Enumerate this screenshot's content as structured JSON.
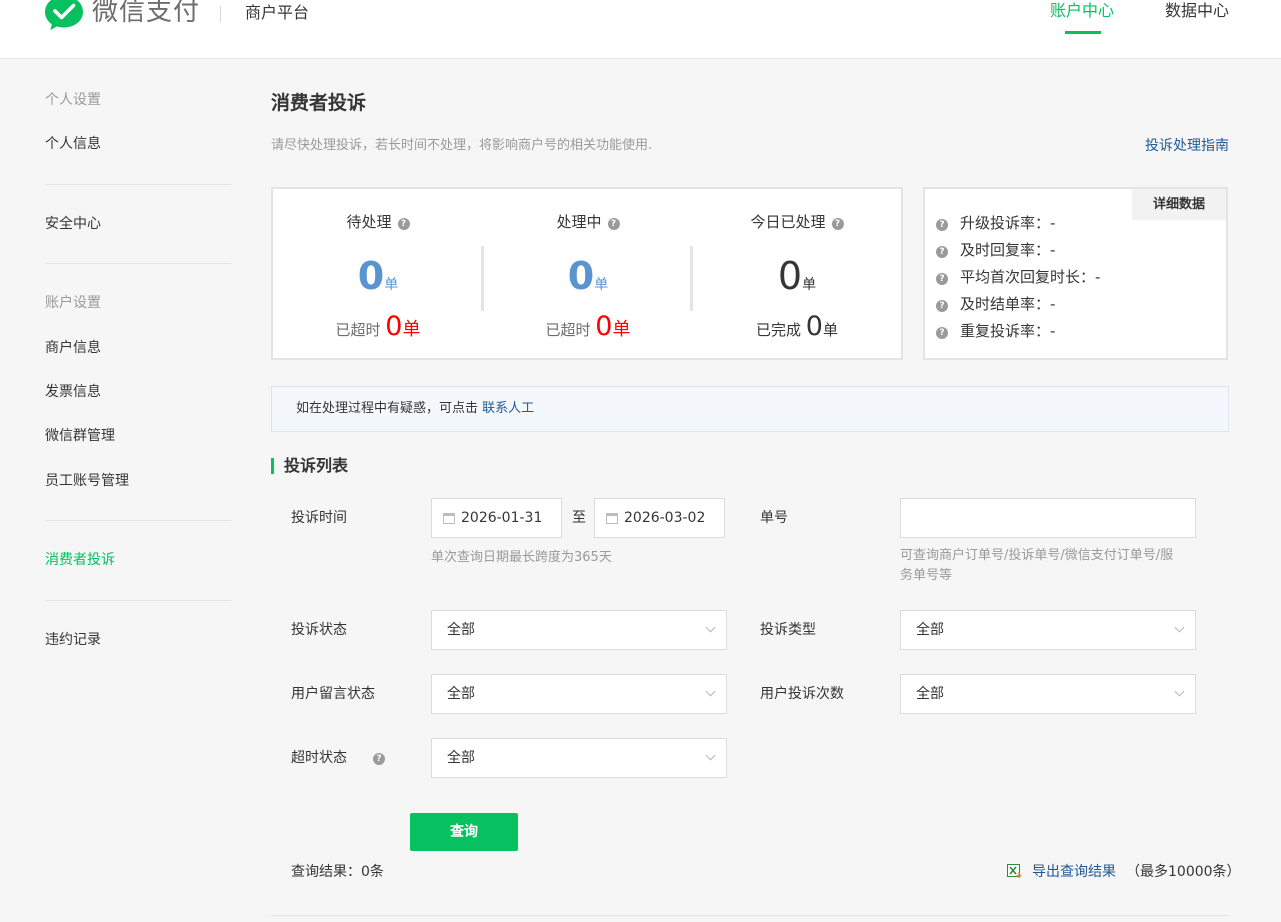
{
  "header": {
    "brand": "微信支付",
    "platform": "商户平台",
    "nav": {
      "account_center": "账户中心",
      "data_center": "数据中心"
    }
  },
  "sidebar": {
    "group_personal": "个人设置",
    "personal_info": "个人信息",
    "security_center": "安全中心",
    "group_account": "账户设置",
    "merchant_info": "商户信息",
    "invoice_info": "发票信息",
    "wechat_group": "微信群管理",
    "staff_account": "员工账号管理",
    "consumer_complaints": "消费者投诉",
    "violation_records": "违约记录"
  },
  "main": {
    "title": "消费者投诉",
    "description": "请尽快处理投诉，若长时间不处理，将影响商户号的相关功能使用.",
    "guide_link": "投诉处理指南"
  },
  "stats": {
    "pending": {
      "title": "待处理",
      "value": "0",
      "unit": "单",
      "sub_label": "已超时",
      "sub_value": "0",
      "sub_unit": "单"
    },
    "processing": {
      "title": "处理中",
      "value": "0",
      "unit": "单",
      "sub_label": "已超时",
      "sub_value": "0",
      "sub_unit": "单"
    },
    "today_done": {
      "title": "今日已处理",
      "value": "0",
      "unit": "单",
      "sub_label": "已完成",
      "sub_value": "0",
      "sub_unit": "单"
    }
  },
  "detail": {
    "tag": "详细数据",
    "rows": [
      {
        "label": "升级投诉率：",
        "value": "-"
      },
      {
        "label": "及时回复率：",
        "value": "-"
      },
      {
        "label": "平均首次回复时长：",
        "value": "-"
      },
      {
        "label": "及时结单率：",
        "value": "-"
      },
      {
        "label": "重复投诉率：",
        "value": "-"
      }
    ]
  },
  "notice": {
    "text": "如在处理过程中有疑惑，可点击 ",
    "link": "联系人工"
  },
  "complaint_list": {
    "title": "投诉列表",
    "time_label": "投诉时间",
    "date_from": "2026-01-31",
    "to_text": "至",
    "date_to": "2026-03-02",
    "date_hint": "单次查询日期最长跨度为365天",
    "order_label": "单号",
    "order_value": "",
    "order_hint_line1": "可查询商户订单号/投诉单号/微信支付订单号/服",
    "order_hint_line2": "务单号等",
    "status_label": "投诉状态",
    "status_value": "全部",
    "type_label": "投诉类型",
    "type_value": "全部",
    "message_label": "用户留言状态",
    "message_value": "全部",
    "count_label": "用户投诉次数",
    "count_value": "全部",
    "timeout_label": "超时状态",
    "timeout_value": "全部",
    "query_button": "查询",
    "result_count": "查询结果：0条",
    "export_link": "导出查询结果",
    "export_note": "（最多10000条）"
  },
  "colors": {
    "brand_green": "#07c160",
    "link_blue": "#1e5a96",
    "stat_blue": "#5a94d0",
    "alert_red": "#ff0000"
  }
}
